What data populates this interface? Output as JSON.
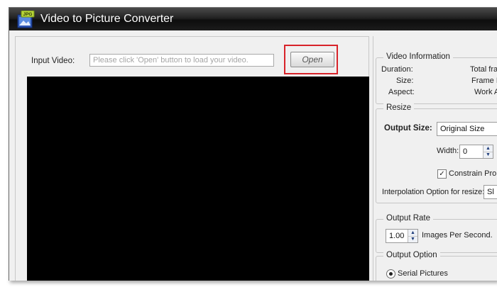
{
  "window": {
    "title": "Video to Picture Converter",
    "icon_label": "JPG"
  },
  "input": {
    "label": "Input Video:",
    "value": "",
    "placeholder": "Please click 'Open' button to load your video.",
    "open_label": "Open"
  },
  "video_info": {
    "title": "Video Information",
    "duration_label": "Duration:",
    "size_label": "Size:",
    "aspect_label": "Aspect:",
    "total_frames_label": "Total fra",
    "frame_rate_label": "Frame R",
    "work_label": "Work A"
  },
  "resize": {
    "title": "Resize",
    "output_size_label": "Output Size:",
    "output_size_value": "Original Size",
    "width_label": "Width:",
    "width_value": "0",
    "constrain_label": "Constrain Pro",
    "constrain_checked": true,
    "interp_label": "Interpolation Option for resize:",
    "interp_value": "Sl"
  },
  "output_rate": {
    "title": "Output Rate",
    "value": "1.00",
    "unit_label": "Images Per Second."
  },
  "output_option": {
    "title": "Output Option",
    "serial_label": "Serial Pictures",
    "serial_selected": true
  },
  "colors": {
    "highlight": "#d8232a",
    "video_bg": "#000000"
  }
}
